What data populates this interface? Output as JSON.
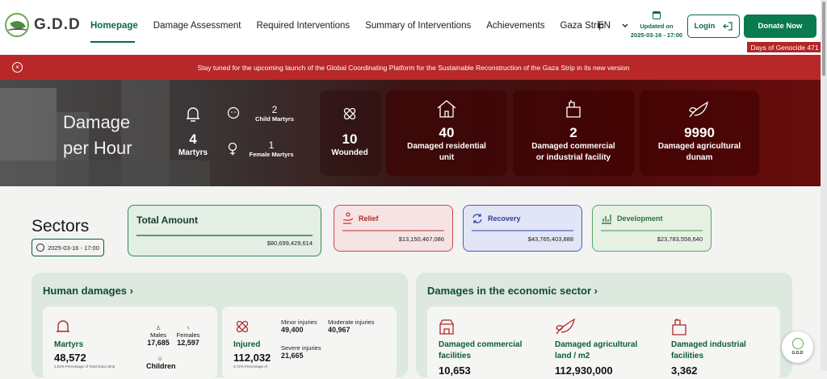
{
  "header": {
    "logo_text": "G.D.D",
    "nav": [
      "Homepage",
      "Damage Assessment",
      "Required Interventions",
      "Summary of Interventions",
      "Achievements",
      "Gaza Strip"
    ],
    "lang": "EN",
    "updated_label": "Updated on",
    "updated_time": "2025-03-16 - 17:00",
    "login": "Login",
    "donate": "Donate Now",
    "genocide_days": "Days of Genocide 471"
  },
  "banner": {
    "text": "Stay tuned for the upcoming launch of the Global Coordinating Platform for the Sustainable Reconstruction of the Gaza Strip in its new version"
  },
  "hero": {
    "title": "Damage per Hour",
    "martyrs": {
      "value": "4",
      "label": "Martyrs"
    },
    "child_martyrs": {
      "value": "2",
      "label": "Child Martyrs"
    },
    "female_martyrs": {
      "value": "1",
      "label": "Female Martyrs"
    },
    "wounded": {
      "value": "10",
      "label": "Wounded"
    },
    "residential": {
      "value": "40",
      "label1": "Damaged residential",
      "label2": "unit"
    },
    "commercial": {
      "value": "2",
      "label1": "Damaged commercial",
      "label2": "or industrial facility"
    },
    "agricultural": {
      "value": "9990",
      "label1": "Damaged agricultural",
      "label2": "dunam"
    }
  },
  "sectors": {
    "title": "Sectors",
    "date": "2025-03-16 - 17:00",
    "total_label": "Total Amount",
    "total_value": "$80,699,429,614",
    "relief_label": "Relief",
    "relief_value": "$13,150,467,086",
    "recovery_label": "Recovery",
    "recovery_value": "$43,765,403,888",
    "development_label": "Development",
    "development_value": "$23,783,558,640"
  },
  "human": {
    "title": "Human damages",
    "martyrs_label": "Martyrs",
    "martyrs_value": "48,572",
    "martyrs_note": "2.04% Percentage of Total Gaza Strip",
    "males_label": "Males",
    "males_value": "17,685",
    "females_label": "Females",
    "females_value": "12,597",
    "children_label": "Children",
    "injured_label": "Injured",
    "injured_value": "112,032",
    "injured_note": "4.72% Percentage of",
    "minor_label": "Minor injuries",
    "minor_value": "49,400",
    "moderate_label": "Moderate injuries",
    "moderate_value": "40,967",
    "severe_label": "Severe injuries",
    "severe_value": "21,665"
  },
  "economic": {
    "title": "Damages in the economic sector",
    "commercial_label1": "Damaged commercial",
    "commercial_label2": "facilities",
    "commercial_value": "10,653",
    "agri_label1": "Damaged agricultural",
    "agri_label2": "land / m2",
    "agri_value": "112,930,000",
    "industrial_label1": "Damaged industrial",
    "industrial_label2": "facilities",
    "industrial_value": "3,362"
  },
  "float_badge": {
    "text": "G.D.D"
  }
}
